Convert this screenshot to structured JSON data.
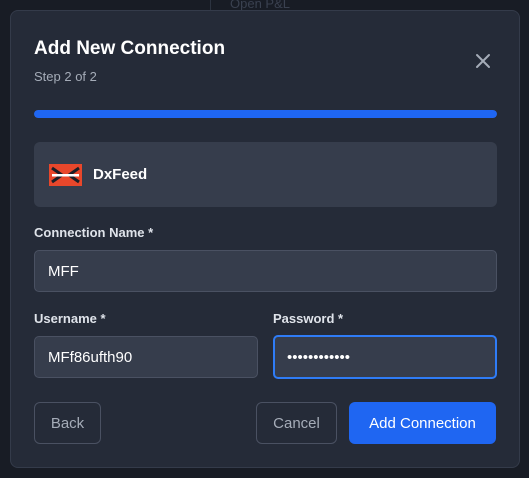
{
  "background": {
    "header_text": "Open P&L"
  },
  "dialog": {
    "title": "Add New Connection",
    "step": "Step 2 of 2",
    "progress": 1.0,
    "provider": {
      "name": "DxFeed",
      "icon": "dxfeed-logo"
    },
    "fields": {
      "connection_name": {
        "label": "Connection Name *",
        "value": "MFF"
      },
      "username": {
        "label": "Username *",
        "value": "MFf86ufth90"
      },
      "password": {
        "label": "Password *",
        "value": "••••••••••••"
      }
    },
    "buttons": {
      "back": "Back",
      "cancel": "Cancel",
      "submit": "Add Connection"
    }
  },
  "colors": {
    "accent": "#1f66f2",
    "modal_bg": "#252b38",
    "input_bg": "#363d4c",
    "focus_border": "#2f7cf6"
  }
}
